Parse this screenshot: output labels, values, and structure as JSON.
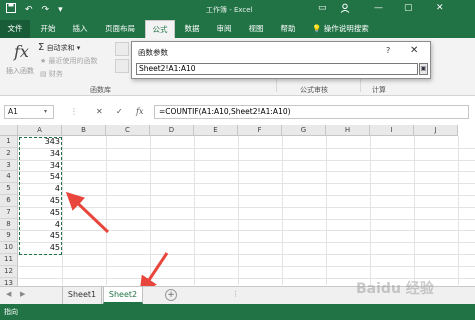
{
  "window": {
    "title_left": "工作簿",
    "title_right": "Excel",
    "icons": [
      "save-icon",
      "undo-icon",
      "redo-icon",
      "customize-qat-icon"
    ],
    "accent_color": "#217346"
  },
  "ribbon_tabs": [
    "文件",
    "开始",
    "插入",
    "页面布局",
    "公式",
    "数据",
    "审阅",
    "视图",
    "帮助"
  ],
  "active_tab": "公式",
  "tell_me": "操作说明搜索",
  "ribbon": {
    "insert_function": "插入函数",
    "autosum": "自动求和",
    "recent": "最近使用的函数",
    "finance": "财务",
    "function_library": "函数库",
    "formula_auditing": "公式审核",
    "calculation": "计算"
  },
  "dialog": {
    "title": "函数参数",
    "help": "?",
    "close": "✕",
    "input_value": "Sheet2!A1:A10"
  },
  "formula_bar": {
    "name_box": "A1",
    "cancel": "✕",
    "enter": "✓",
    "fx": "fx",
    "formula": "=COUNTIF(A1:A10,Sheet2!A1:A10)"
  },
  "grid": {
    "columns": [
      "A",
      "B",
      "C",
      "D",
      "E",
      "F",
      "G",
      "H",
      "I",
      "J"
    ],
    "rows": [
      "1",
      "2",
      "3",
      "4",
      "5",
      "6",
      "7",
      "8",
      "9",
      "10",
      "11",
      "12",
      "13"
    ],
    "col_a_values": [
      "343",
      "34",
      "34",
      "54",
      "4",
      "45",
      "45",
      "4",
      "45",
      "45"
    ]
  },
  "sheets": [
    "Sheet1",
    "Sheet2"
  ],
  "active_sheet": "Sheet2",
  "status": "指向",
  "watermark": "Baidu 经验"
}
